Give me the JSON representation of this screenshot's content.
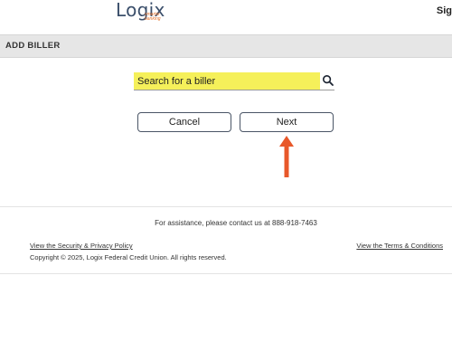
{
  "header": {
    "logo_text": "Logix",
    "logo_tagline": "smarter banking",
    "sign_label": "Sig"
  },
  "titlebar": {
    "title": "ADD BILLER"
  },
  "search": {
    "placeholder": "Search for a biller",
    "value": ""
  },
  "buttons": {
    "cancel_label": "Cancel",
    "next_label": "Next"
  },
  "footer": {
    "assistance": "For assistance, please contact us at 888-918-7463",
    "privacy_link": "View the Security & Privacy Policy",
    "terms_link": "View the Terms & Conditions",
    "copyright": "Copyright © 2025, Logix Federal Credit Union.  All rights reserved."
  },
  "colors": {
    "search_highlight": "#f5f05a",
    "arrow": "#e8582a",
    "logo_blue": "#3b4f6b",
    "logo_orange": "#e5732c"
  },
  "icons": {
    "search": "search-icon",
    "annotation": "arrow-up-icon"
  }
}
